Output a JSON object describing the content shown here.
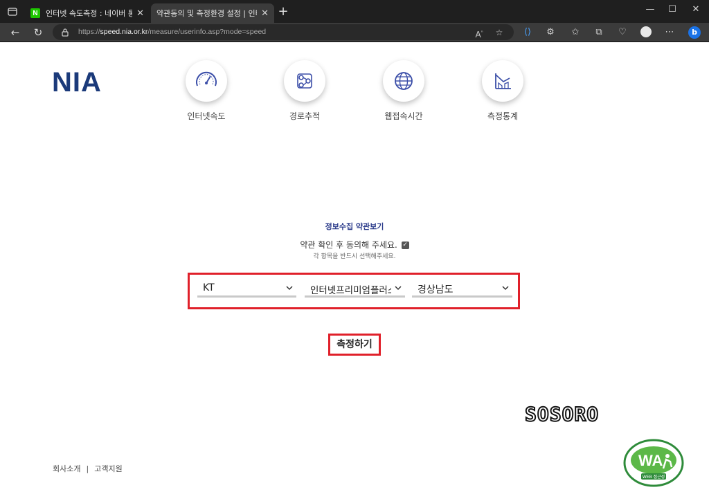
{
  "browser": {
    "tabs": [
      {
        "title": "인터넷 속도측정 : 네이버 통합검색",
        "favicon": "naver-icon",
        "active": false
      },
      {
        "title": "약관동의 및 측정환경 설정 | 인터넷 속도측정",
        "favicon": "page-icon",
        "active": true
      }
    ],
    "url_scheme": "https://",
    "url_host": "speed.nia.or.kr",
    "url_path": "/measure/userinfo.asp?mode=speed"
  },
  "site": {
    "logo": "NIA",
    "menu": [
      {
        "label": "인터넷속도",
        "icon": "speedometer-icon"
      },
      {
        "label": "경로추적",
        "icon": "route-trace-icon"
      },
      {
        "label": "웹접속시간",
        "icon": "globe-icon"
      },
      {
        "label": "측정통계",
        "icon": "statistics-icon"
      }
    ]
  },
  "form": {
    "terms_link": "정보수집 약관보기",
    "agree_text": "약관 확인 후 동의해 주세요.",
    "agree_checked": true,
    "help_text": "각 항목을 반드시 선택해주세요.",
    "isp": "KT",
    "product": "인터넷프리미엄플러스",
    "region": "경상남도",
    "submit_label": "측정하기"
  },
  "watermark": "SOSORO",
  "footer": {
    "company": "회사소개",
    "support": "고객지원",
    "badge_text": "WEB 접근성"
  },
  "colors": {
    "brand": "#1b3a7a",
    "highlight": "#e0202a",
    "icon_blue": "#3b4ea8"
  }
}
